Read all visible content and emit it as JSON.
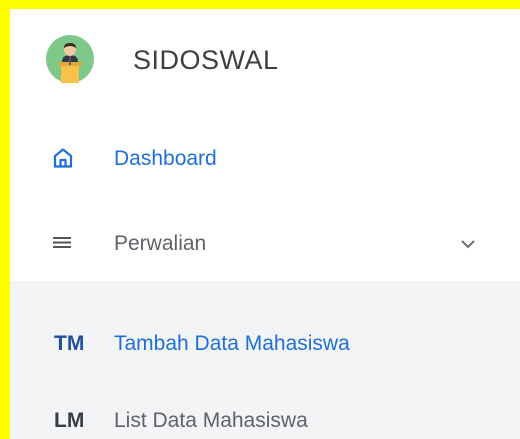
{
  "brand": {
    "name": "SIDOSWAL",
    "avatar_icon": "presenter-avatar-icon"
  },
  "nav": {
    "items": [
      {
        "label": "Dashboard",
        "icon": "home-icon",
        "active": true,
        "color": "#1e6fd9"
      },
      {
        "label": "Perwalian",
        "icon": "menu-lines-icon",
        "expanded": true,
        "chevron": "chevron-down-icon",
        "color": "#5f6368"
      }
    ],
    "submenu": [
      {
        "abbr": "TM",
        "label": "Tambah Data Mahasiswa",
        "active": true
      },
      {
        "abbr": "LM",
        "label": "List Data Mahasiswa",
        "active": false
      }
    ]
  },
  "colors": {
    "page_border": "#ffff00",
    "accent": "#1e6fd9",
    "submenu_bg": "#f3f4f6"
  }
}
